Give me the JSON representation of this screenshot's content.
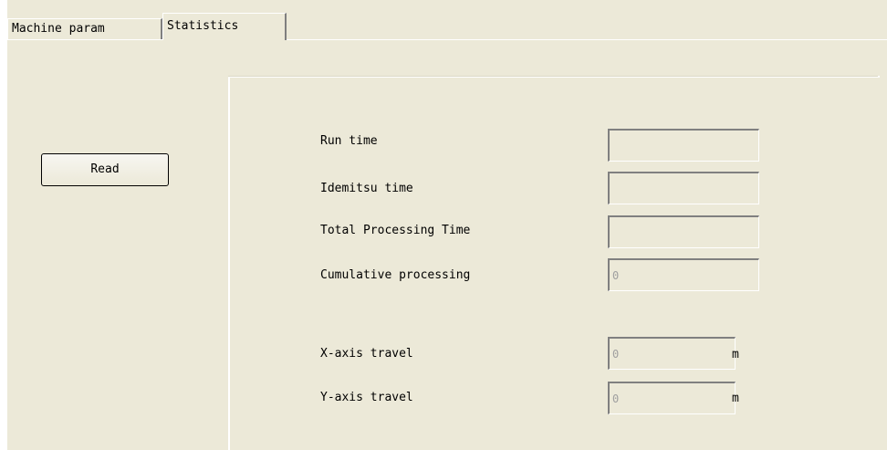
{
  "tabs": [
    {
      "label": "Machine param",
      "active": false
    },
    {
      "label": "Statistics",
      "active": true
    }
  ],
  "read_button": {
    "label": "Read"
  },
  "statistics": {
    "run_time": {
      "label": "Run time",
      "value": ""
    },
    "idemitsu_time": {
      "label": "Idemitsu time",
      "value": ""
    },
    "total_processing_time": {
      "label": "Total Processing Time",
      "value": ""
    },
    "cumulative_processing": {
      "label": "Cumulative processing",
      "value": "0"
    },
    "x_axis_travel": {
      "label": "X-axis travel",
      "value": "0",
      "unit": "m"
    },
    "y_axis_travel": {
      "label": "Y-axis travel",
      "value": "0",
      "unit": "m"
    }
  },
  "colors": {
    "window_background": "#ece9d8",
    "disabled_text": "#a0a0a0"
  }
}
